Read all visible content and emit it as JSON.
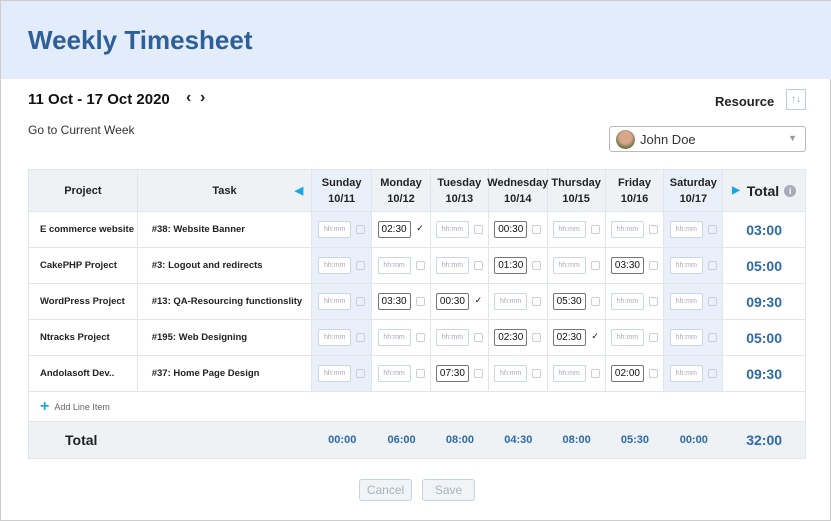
{
  "title": "Weekly Timesheet",
  "week_range": "11 Oct - 17 Oct 2020",
  "go_current": "Go to Current Week",
  "resource": {
    "label": "Resource",
    "selected": "John Doe"
  },
  "columns": {
    "project": "Project",
    "task": "Task",
    "total": "Total",
    "days": [
      {
        "name": "Sunday",
        "date": "10/11",
        "weekend": true
      },
      {
        "name": "Monday",
        "date": "10/12"
      },
      {
        "name": "Tuesday",
        "date": "10/13"
      },
      {
        "name": "Wednesday",
        "date": "10/14"
      },
      {
        "name": "Thursday",
        "date": "10/15"
      },
      {
        "name": "Friday",
        "date": "10/16"
      },
      {
        "name": "Saturday",
        "date": "10/17",
        "weekend": true
      }
    ]
  },
  "placeholder": "hh:mm",
  "rows": [
    {
      "project": "E commerce website",
      "task": "#38:  Website Banner",
      "hours": [
        "",
        "02:30",
        "",
        "00:30",
        "",
        "",
        ""
      ],
      "checked": [
        false,
        true,
        false,
        false,
        false,
        false,
        false
      ],
      "total": "03:00"
    },
    {
      "project": "CakePHP Project",
      "task": "#3:  Logout and redirects",
      "hours": [
        "",
        "",
        "",
        "01:30",
        "",
        "03:30",
        ""
      ],
      "checked": [
        false,
        false,
        false,
        false,
        false,
        false,
        false
      ],
      "total": "05:00"
    },
    {
      "project": "WordPress Project",
      "task": "#13:  QA-Resourcing functionslity",
      "hours": [
        "",
        "03:30",
        "00:30",
        "",
        "05:30",
        "",
        ""
      ],
      "checked": [
        false,
        false,
        true,
        false,
        false,
        false,
        false
      ],
      "total": "09:30"
    },
    {
      "project": "Ntracks Project",
      "task": "#195:  Web Designing",
      "hours": [
        "",
        "",
        "",
        "02:30",
        "02:30",
        "",
        ""
      ],
      "checked": [
        false,
        false,
        false,
        false,
        true,
        false,
        false
      ],
      "total": "05:00"
    },
    {
      "project": "Andolasoft Dev..",
      "task": "#37:  Home Page Design",
      "hours": [
        "",
        "",
        "07:30",
        "",
        "",
        "02:00",
        ""
      ],
      "checked": [
        false,
        false,
        false,
        false,
        false,
        false,
        false
      ],
      "total": "09:30"
    }
  ],
  "add_line": "Add Line Item",
  "totals": {
    "label": "Total",
    "days": [
      "00:00",
      "06:00",
      "08:00",
      "04:30",
      "08:00",
      "05:30",
      "00:00"
    ],
    "grand": "32:00"
  },
  "buttons": {
    "cancel": "Cancel",
    "save": "Save"
  }
}
